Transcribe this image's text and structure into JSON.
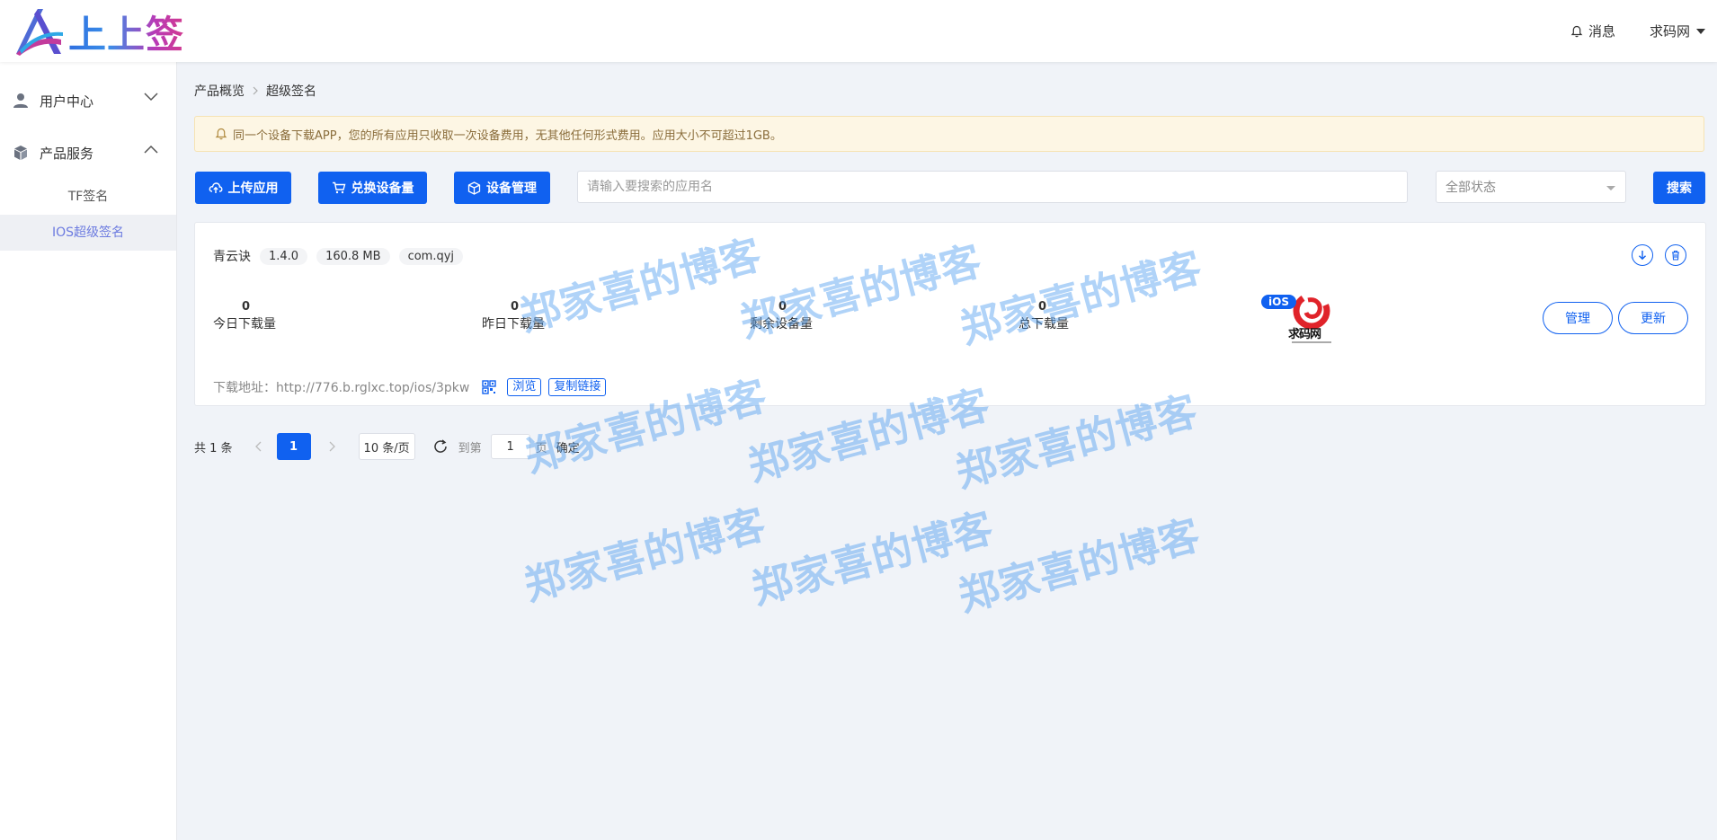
{
  "header": {
    "logo_text": "上上签",
    "notifications_label": "消息",
    "user_label": "求码网"
  },
  "sidebar": {
    "groups": [
      {
        "label": "用户中心"
      },
      {
        "label": "产品服务",
        "items": [
          {
            "label": "TF签名"
          },
          {
            "label": "IOS超级签名"
          }
        ]
      }
    ]
  },
  "breadcrumb": [
    "产品概览",
    "超级签名"
  ],
  "notice": "同一个设备下载APP，您的所有应用只收取一次设备费用，无其他任何形式费用。应用大小不可超过1GB。",
  "toolbar": {
    "upload_label": "上传应用",
    "exchange_label": "兑换设备量",
    "devices_label": "设备管理",
    "search_placeholder": "请输入要搜索的应用名",
    "status_select": "全部状态",
    "search_label": "搜索"
  },
  "app": {
    "name": "青云诀",
    "version": "1.4.0",
    "size": "160.8 MB",
    "bundle": "com.qyj",
    "stats": [
      {
        "value": "0",
        "label": "今日下载量"
      },
      {
        "value": "0",
        "label": "昨日下载量"
      },
      {
        "value": "0",
        "label": "剩余设备量"
      },
      {
        "value": "0",
        "label": "总下载量"
      }
    ],
    "platform_badge": "iOS",
    "icon_text": "求码网",
    "manage_label": "管理",
    "update_label": "更新",
    "download_prefix": "下载地址：",
    "download_url": "http://776.b.rglxc.top/ios/3pkw",
    "browse_label": "浏览",
    "copy_label": "复制链接"
  },
  "pagination": {
    "total": "共 1 条",
    "current": "1",
    "page_size": "10 条/页",
    "goto_label": "到第",
    "goto_value": "1",
    "page_unit": "页",
    "confirm_label": "确定"
  },
  "watermark": "郑家喜的博客",
  "colors": {
    "primary": "#1061f0",
    "background": "#f0f3f8",
    "notice_bg": "#fdf6e4",
    "watermark": "#4296ee"
  }
}
